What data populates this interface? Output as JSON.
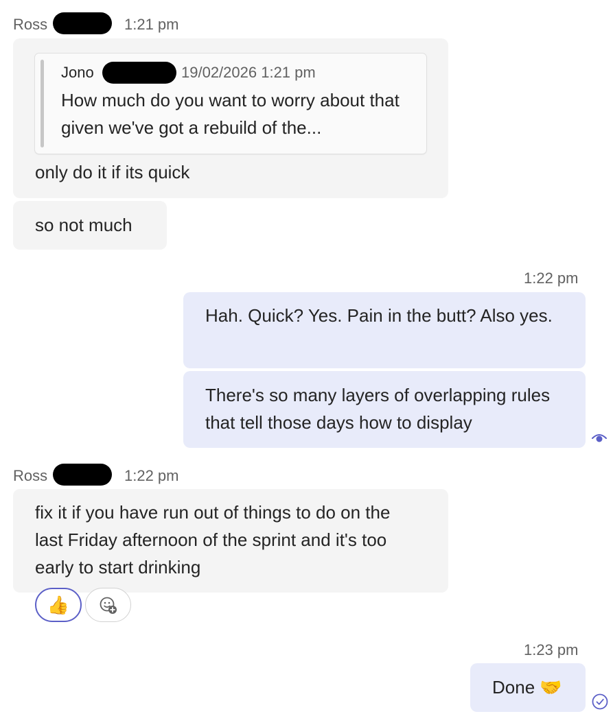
{
  "messages": [
    {
      "sender": "Ross",
      "time": "1:21 pm",
      "quote": {
        "author": "Jono",
        "time": "19/02/2026 1:21 pm",
        "text": "How much do you want to worry about that given we've got a rebuild of the..."
      },
      "text": "only do it if its quick"
    },
    {
      "text": "so not much"
    },
    {
      "time": "1:22 pm",
      "text_1": "Hah. Quick? Yes. Pain in the butt? Also yes.",
      "text_2": "There's so many layers of overlapping rules that tell those days how to display",
      "status_icon": "seen-eye-icon"
    },
    {
      "sender": "Ross",
      "time": "1:22 pm",
      "text": "fix it if you have run out of things to do on the last Friday afternoon of the sprint and it's too early to start drinking",
      "reactions": [
        {
          "emoji": "👍",
          "name": "thumbs-up"
        },
        {
          "icon": "add-reaction-icon"
        }
      ]
    },
    {
      "time": "1:23 pm",
      "text": "Done 🤝",
      "status_icon": "sent-check-icon"
    }
  ],
  "colors": {
    "received_bubble": "#f4f4f4",
    "sent_bubble": "#e8ebfa",
    "accent": "#5b5fc7",
    "meta_text": "#616161"
  }
}
